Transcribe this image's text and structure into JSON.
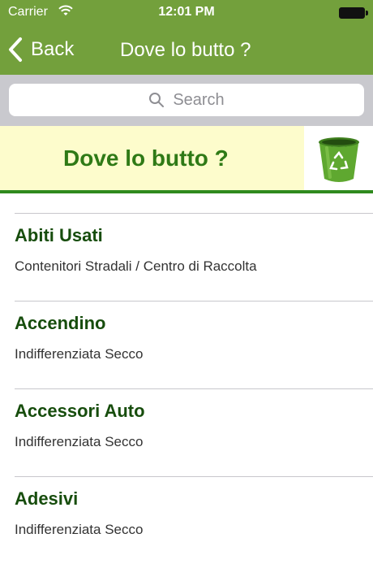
{
  "status_bar": {
    "carrier": "Carrier",
    "time": "12:01 PM"
  },
  "nav": {
    "back_label": "Back",
    "title": "Dove lo butto ?"
  },
  "search": {
    "placeholder": "Search"
  },
  "banner": {
    "title": "Dove lo butto ?"
  },
  "items": [
    {
      "title": "Abiti Usati",
      "subtitle": "Contenitori Stradali / Centro di Raccolta"
    },
    {
      "title": "Accendino",
      "subtitle": "Indifferenziata Secco"
    },
    {
      "title": "Accessori Auto",
      "subtitle": "Indifferenziata Secco"
    },
    {
      "title": "Adesivi",
      "subtitle": "Indifferenziata Secco"
    }
  ],
  "icons": {
    "search": "search-icon",
    "back": "chevron-left-icon",
    "bin": "recycle-bin-icon",
    "wifi": "wifi-icon",
    "battery": "battery-icon"
  },
  "colors": {
    "nav": "#73a03c",
    "banner_bg": "#fdfccc",
    "banner_text": "#2f7a16",
    "item_title": "#174d0d"
  }
}
